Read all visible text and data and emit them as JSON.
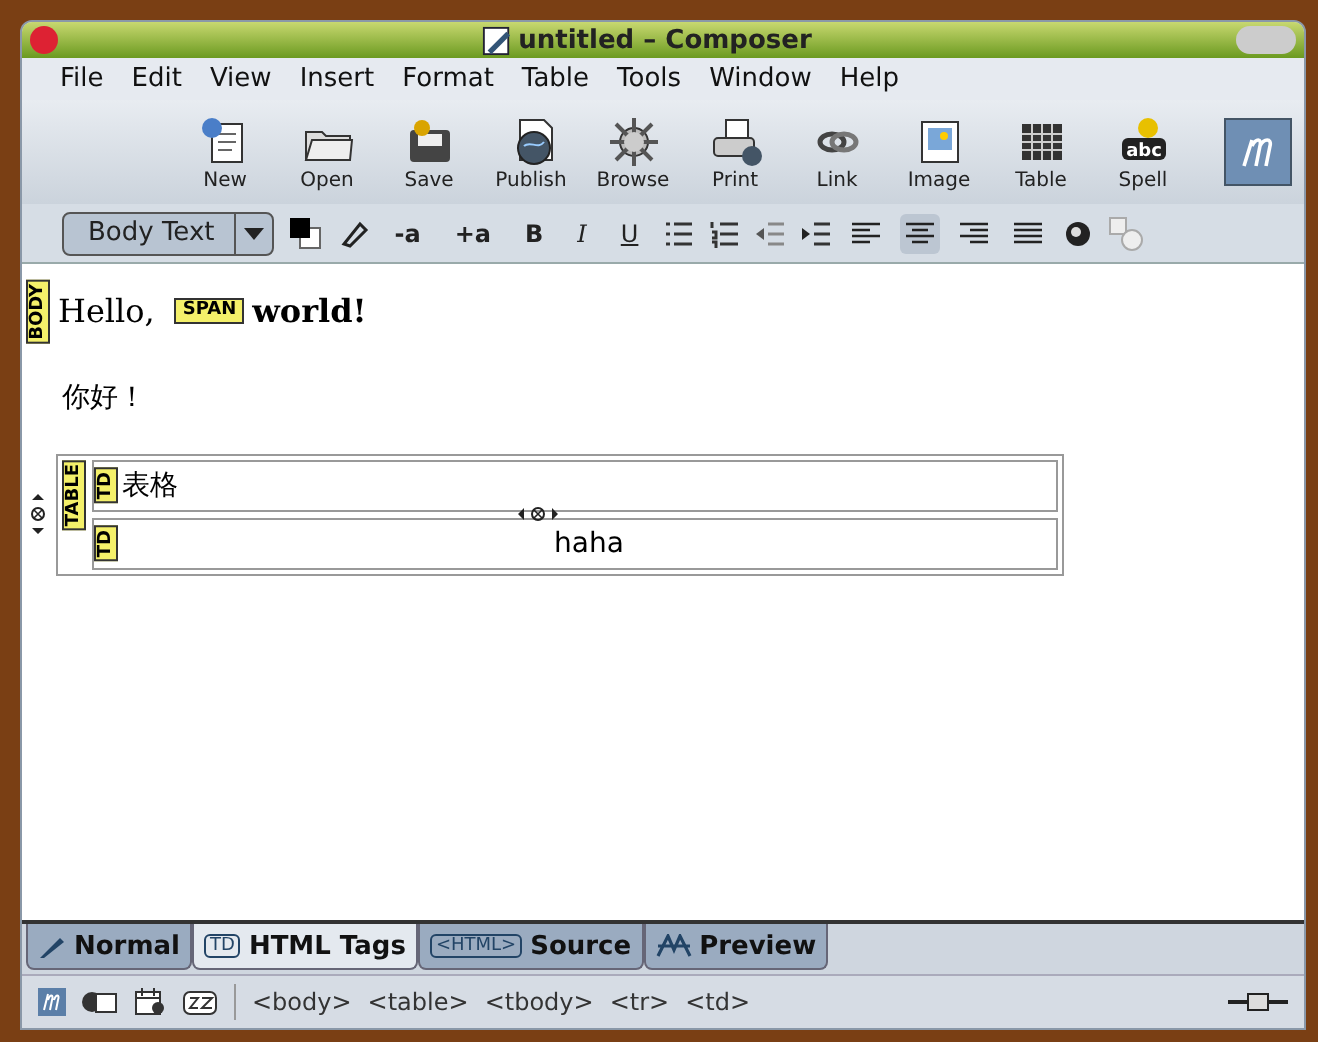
{
  "window": {
    "title": "untitled – Composer"
  },
  "menu": [
    "File",
    "Edit",
    "View",
    "Insert",
    "Format",
    "Table",
    "Tools",
    "Window",
    "Help"
  ],
  "toolbar": [
    {
      "kind": "new",
      "label": "New"
    },
    {
      "kind": "open",
      "label": "Open"
    },
    {
      "kind": "save",
      "label": "Save"
    },
    {
      "kind": "publish",
      "label": "Publish"
    },
    {
      "kind": "browse",
      "label": "Browse"
    },
    {
      "kind": "print",
      "label": "Print"
    },
    {
      "kind": "link",
      "label": "Link"
    },
    {
      "kind": "image",
      "label": "Image"
    },
    {
      "kind": "table",
      "label": "Table"
    },
    {
      "kind": "spell",
      "label": "Spell",
      "icon_text": "abc"
    }
  ],
  "format_bar": {
    "paragraph_style": "Body Text",
    "text_buttons": [
      {
        "kind": "small",
        "label": "-a"
      },
      {
        "kind": "large",
        "label": "+a"
      },
      {
        "kind": "bold",
        "label": "B"
      },
      {
        "kind": "italic",
        "label": "I"
      },
      {
        "kind": "underline",
        "label": "U"
      }
    ],
    "align_buttons": [
      {
        "kind": "left",
        "selected": false
      },
      {
        "kind": "center",
        "selected": true
      },
      {
        "kind": "right",
        "selected": false
      },
      {
        "kind": "justify",
        "selected": false
      }
    ]
  },
  "document": {
    "body_tag": "BODY",
    "hello": "Hello,",
    "span_tag": "SPAN",
    "world": "world!",
    "chinese_line": "你好！",
    "table_tag": "TABLE",
    "rows": [
      {
        "tag": "TD",
        "text": "表格"
      },
      {
        "tag": "TD",
        "text": "haha"
      }
    ]
  },
  "tabs": [
    {
      "label": "Normal",
      "selected": false
    },
    {
      "label": "HTML Tags",
      "icon_text": "TD",
      "selected": true
    },
    {
      "label": "Source",
      "icon_text": "<HTML>",
      "selected": false
    },
    {
      "label": "Preview",
      "selected": false
    }
  ],
  "status_bar": {
    "tags": [
      "<body>",
      "<table>",
      "<tbody>",
      "<tr>",
      "<td>"
    ]
  }
}
